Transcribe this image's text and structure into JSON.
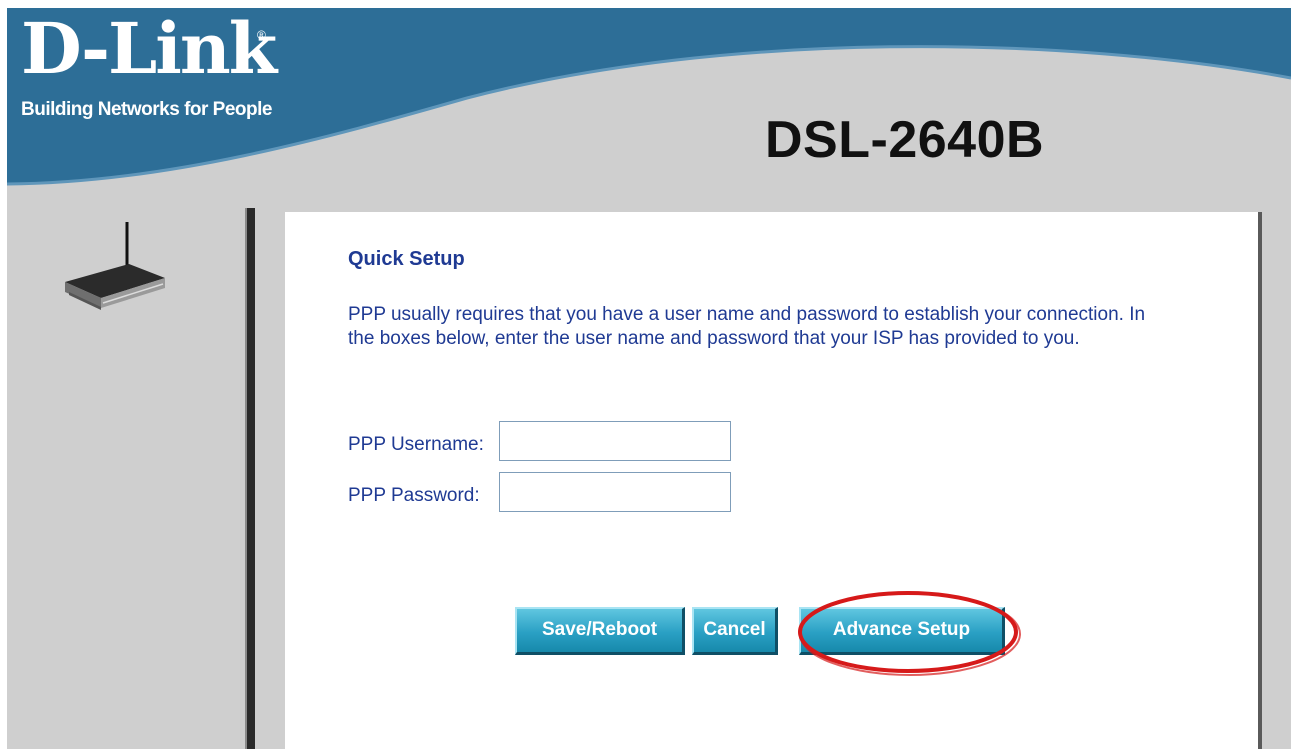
{
  "brand": {
    "logo_text": "D-Link",
    "registered_mark": "®",
    "tagline": "Building Networks for People",
    "model": "DSL-2640B"
  },
  "colors": {
    "banner_blue": "#2d6e97",
    "panel_gray": "#cfcfcf",
    "text_blue": "#1f3a93",
    "button_teal": "#2aa0c4",
    "highlight_red": "#d61a1a"
  },
  "page": {
    "title": "Quick Setup",
    "description": "PPP usually requires that you have a user name and password to establish your connection. In the boxes below, enter the user name and password that your ISP has provided to you."
  },
  "form": {
    "username": {
      "label": "PPP Username:",
      "value": ""
    },
    "password": {
      "label": "PPP Password:",
      "value": ""
    }
  },
  "buttons": {
    "save_reboot": "Save/Reboot",
    "cancel": "Cancel",
    "advance_setup": "Advance Setup"
  }
}
